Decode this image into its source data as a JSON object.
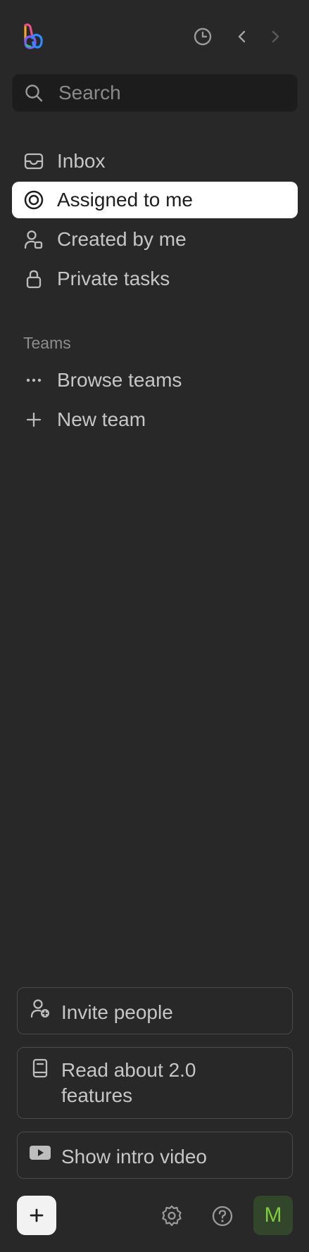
{
  "colors": {
    "background": "#282828",
    "search_bg": "#1c1c1c",
    "active_bg": "#ffffff",
    "text": "#c6c6c6",
    "muted": "#8d8d8d",
    "avatar_bg": "#32462b",
    "avatar_text": "#7fca3f"
  },
  "topbar": {
    "logo_icon": "app-logo",
    "history_icon": "clock-icon",
    "back_icon": "chevron-left-icon",
    "forward_icon": "chevron-right-icon"
  },
  "search": {
    "placeholder": "Search",
    "value": "",
    "icon": "search-icon"
  },
  "nav": {
    "items": [
      {
        "label": "Inbox",
        "icon": "inbox-icon",
        "active": false
      },
      {
        "label": "Assigned to me",
        "icon": "target-icon",
        "active": true
      },
      {
        "label": "Created by me",
        "icon": "user-created-icon",
        "active": false
      },
      {
        "label": "Private tasks",
        "icon": "lock-icon",
        "active": false
      }
    ]
  },
  "teams": {
    "section_label": "Teams",
    "items": [
      {
        "label": "Browse teams",
        "icon": "ellipsis-icon"
      },
      {
        "label": "New team",
        "icon": "plus-icon"
      }
    ]
  },
  "cards": {
    "invite": {
      "label": "Invite people",
      "icon": "user-add-icon"
    },
    "read": {
      "label": "Read about 2.0 features",
      "icon": "book-icon"
    },
    "video": {
      "label": "Show intro video",
      "icon": "youtube-icon"
    }
  },
  "footer": {
    "add_icon": "plus-icon",
    "settings_icon": "gear-icon",
    "help_icon": "help-icon",
    "avatar_initial": "M"
  }
}
